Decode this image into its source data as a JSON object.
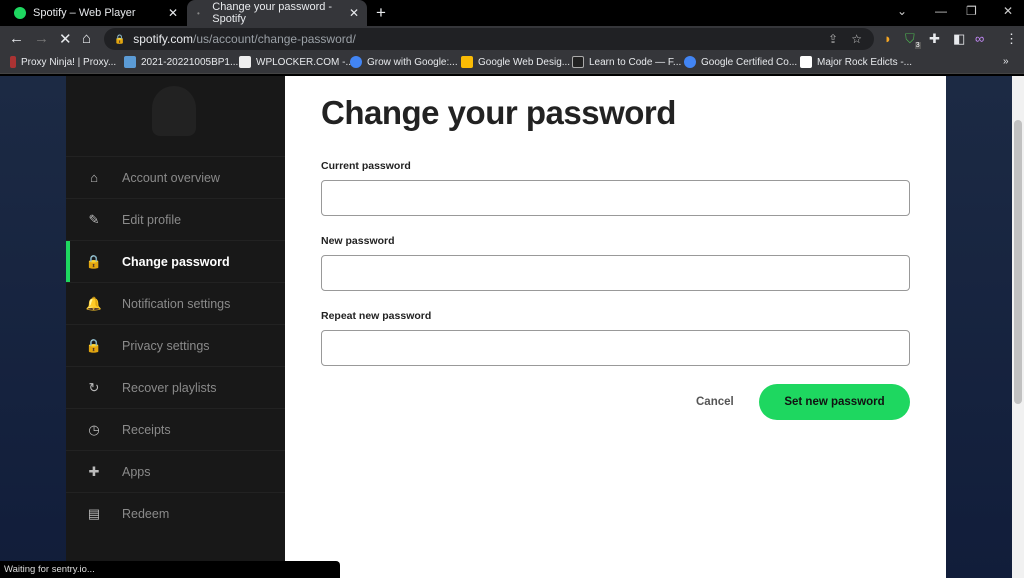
{
  "browser": {
    "tabs": [
      {
        "label": "Spotify – Web Player",
        "close": "✕"
      },
      {
        "label": "Change your password - Spotify",
        "close": "✕"
      }
    ],
    "new_tab": "+",
    "url_host": "spotify.com",
    "url_path": "/us/account/change-password/",
    "extension_badge": "3",
    "bookmarks": [
      "Proxy Ninja! | Proxy...",
      "2021-20221005BP1...",
      "WPLOCKER.COM -...",
      "Grow with Google:...",
      "Google Web Desig...",
      "Learn to Code — F...",
      "Google Certified Co...",
      "Major Rock Edicts -..."
    ],
    "status": "Waiting for sentry.io..."
  },
  "sidebar": {
    "items": [
      {
        "label": "Account overview",
        "icon": "home-icon",
        "glyph": "⌂"
      },
      {
        "label": "Edit profile",
        "icon": "pencil-icon",
        "glyph": "✎"
      },
      {
        "label": "Change password",
        "icon": "lock-icon",
        "glyph": "🔒",
        "active": true
      },
      {
        "label": "Notification settings",
        "icon": "bell-icon",
        "glyph": "🔔"
      },
      {
        "label": "Privacy settings",
        "icon": "lock-icon",
        "glyph": "🔒"
      },
      {
        "label": "Recover playlists",
        "icon": "refresh-icon",
        "glyph": "↻"
      },
      {
        "label": "Receipts",
        "icon": "clock-icon",
        "glyph": "◷"
      },
      {
        "label": "Apps",
        "icon": "puzzle-icon",
        "glyph": "✚"
      },
      {
        "label": "Redeem",
        "icon": "card-icon",
        "glyph": "▤"
      }
    ]
  },
  "main": {
    "title": "Change your password",
    "fields": [
      {
        "label": "Current password",
        "value": ""
      },
      {
        "label": "New password",
        "value": ""
      },
      {
        "label": "Repeat new password",
        "value": ""
      }
    ],
    "cancel": "Cancel",
    "submit": "Set new password"
  },
  "colors": {
    "accent": "#1ed760",
    "sidebar": "#181818"
  }
}
